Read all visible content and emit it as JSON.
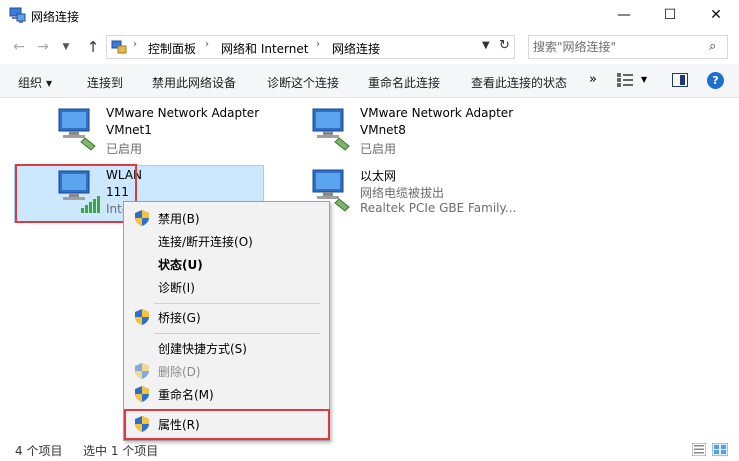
{
  "window": {
    "title": "网络连接",
    "minimize": "—",
    "maximize": "☐",
    "close": "✕"
  },
  "address": {
    "crumbs": [
      "控制面板",
      "网络和 Internet",
      "网络连接"
    ],
    "separator": "›",
    "search_placeholder": "搜索\"网络连接\""
  },
  "toolbar": {
    "organize": "组织",
    "connect_to": "连接到",
    "disable": "禁用此网络设备",
    "diagnose": "诊断这个连接",
    "rename": "重命名此连接",
    "view_status": "查看此连接的状态",
    "more": "»"
  },
  "items": [
    {
      "name": "VMware Network Adapter",
      "line2": "VMnet1",
      "line3": "已启用"
    },
    {
      "name": "VMware Network Adapter",
      "line2": "VMnet8",
      "line3": "已启用"
    },
    {
      "name": "WLAN",
      "line2": "111",
      "line3": "Inte"
    },
    {
      "name": "以太网",
      "line2": "网络电缆被拔出",
      "line3": "Realtek PCIe GBE Family..."
    }
  ],
  "context_menu": {
    "disable": "禁用(B)",
    "connect_disconnect": "连接/断开连接(O)",
    "status": "状态(U)",
    "diagnose": "诊断(I)",
    "bridge": "桥接(G)",
    "create_shortcut": "创建快捷方式(S)",
    "delete": "删除(D)",
    "rename": "重命名(M)",
    "properties": "属性(R)"
  },
  "statusbar": {
    "item_count": "4 个项目",
    "selected": "选中 1 个项目"
  },
  "colors": {
    "selection": "#cce8ff",
    "highlight_box": "#e0393f",
    "help": "#1f6fd1"
  }
}
